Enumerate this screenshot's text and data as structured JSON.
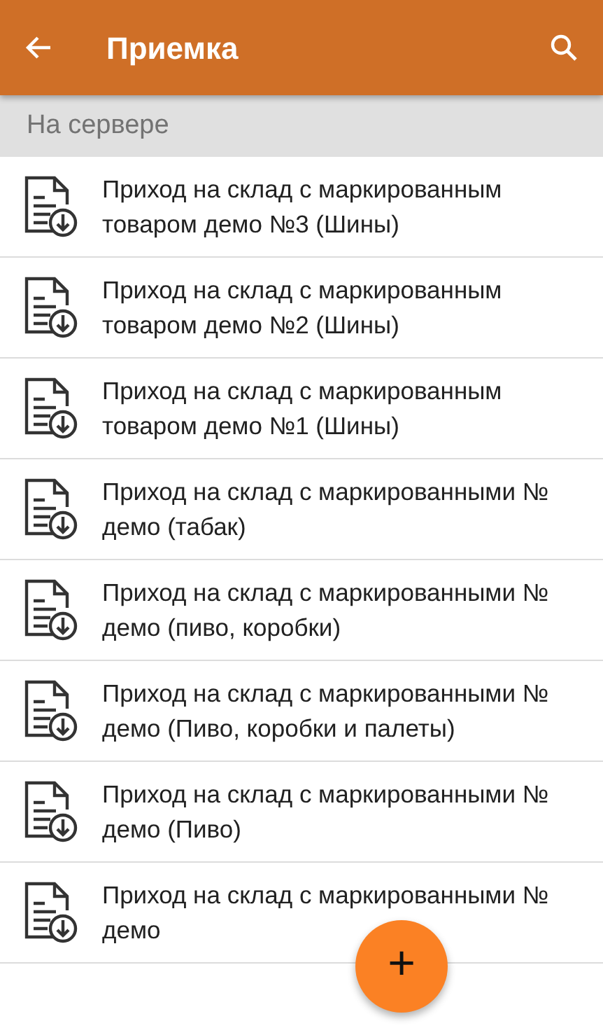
{
  "app_bar": {
    "title": "Приемка"
  },
  "section": {
    "title": "На сервере"
  },
  "documents": [
    {
      "title": "Приход на склад с маркированным товаром демо №3 (Шины)"
    },
    {
      "title": "Приход на склад с маркированным товаром демо №2 (Шины)"
    },
    {
      "title": "Приход на склад с маркированным товаром демо №1 (Шины)"
    },
    {
      "title": "Приход на склад с маркированными № демо (табак)"
    },
    {
      "title": "Приход на склад с маркированными № демо (пиво, коробки)"
    },
    {
      "title": "Приход на склад с маркированными № демо (Пиво, коробки и палеты)"
    },
    {
      "title": "Приход на склад с маркированными № демо (Пиво)"
    },
    {
      "title": "Приход на склад с маркированными № демо"
    }
  ],
  "fab": {
    "label": "+"
  }
}
